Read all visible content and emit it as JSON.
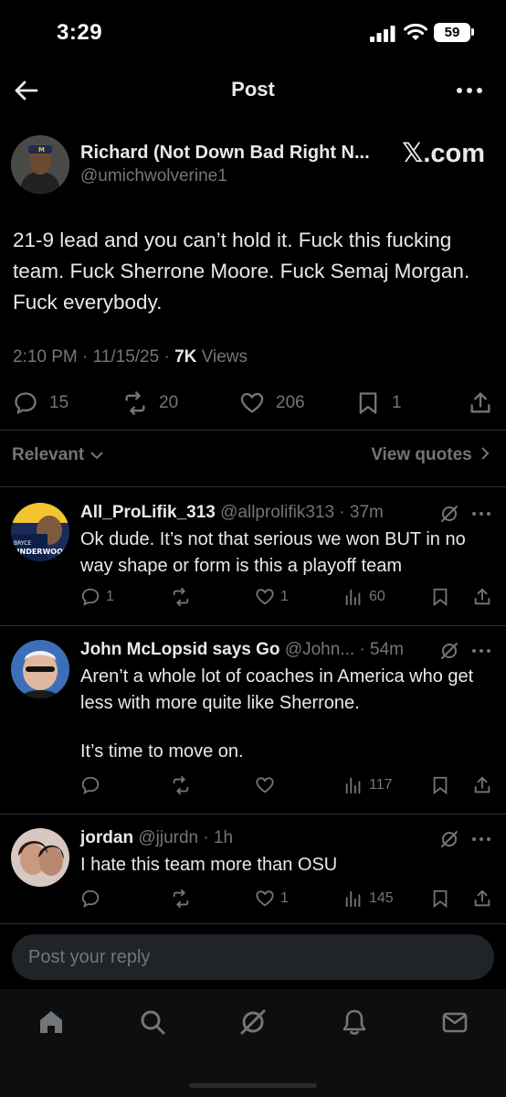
{
  "status_bar": {
    "time": "3:29",
    "battery": "59"
  },
  "header": {
    "title": "Post"
  },
  "post": {
    "author_name": "Richard (Not Down Bad Right N...",
    "author_handle": "@umichwolverine1",
    "watermark": "𝕏.com",
    "text": "21-9 lead and you can’t hold it. Fuck this fucking team. Fuck Sherrone Moore. Fuck Semaj Morgan. Fuck everybody.",
    "meta_time": "2:10 PM · 11/15/25 · ",
    "meta_views_count": "7K",
    "meta_views_label": " Views",
    "stats": {
      "replies": "15",
      "reposts": "20",
      "likes": "206",
      "bookmarks": "1"
    }
  },
  "sort": {
    "relevant_label": "Relevant",
    "view_quotes_label": "View quotes"
  },
  "replies": [
    {
      "name": "All_ProLifik_313",
      "handle": " @allprolifik313 · 37m",
      "text": "Ok dude. It’s not that serious we won BUT in no way shape or form is this a playoff team",
      "replies": "1",
      "reposts": "",
      "likes": "1",
      "views": "60"
    },
    {
      "name": "John McLopsid says Go",
      "handle": " @John... · 54m",
      "text": "Aren’t a whole lot of coaches in America who get less with more quite like Sherrone.",
      "text2": "It’s time to move on.",
      "replies": "",
      "reposts": "",
      "likes": "",
      "views": "117"
    },
    {
      "name": "jordan",
      "handle": " @jjurdn · 1h",
      "text": "I hate this team more than OSU",
      "replies": "",
      "reposts": "",
      "likes": "1",
      "views": "145"
    }
  ],
  "reply_box": {
    "placeholder": "Post your reply"
  },
  "colors": {
    "background": "#000000",
    "text": "#e7e9ea",
    "muted": "#71767b",
    "divider": "#2f3336"
  }
}
